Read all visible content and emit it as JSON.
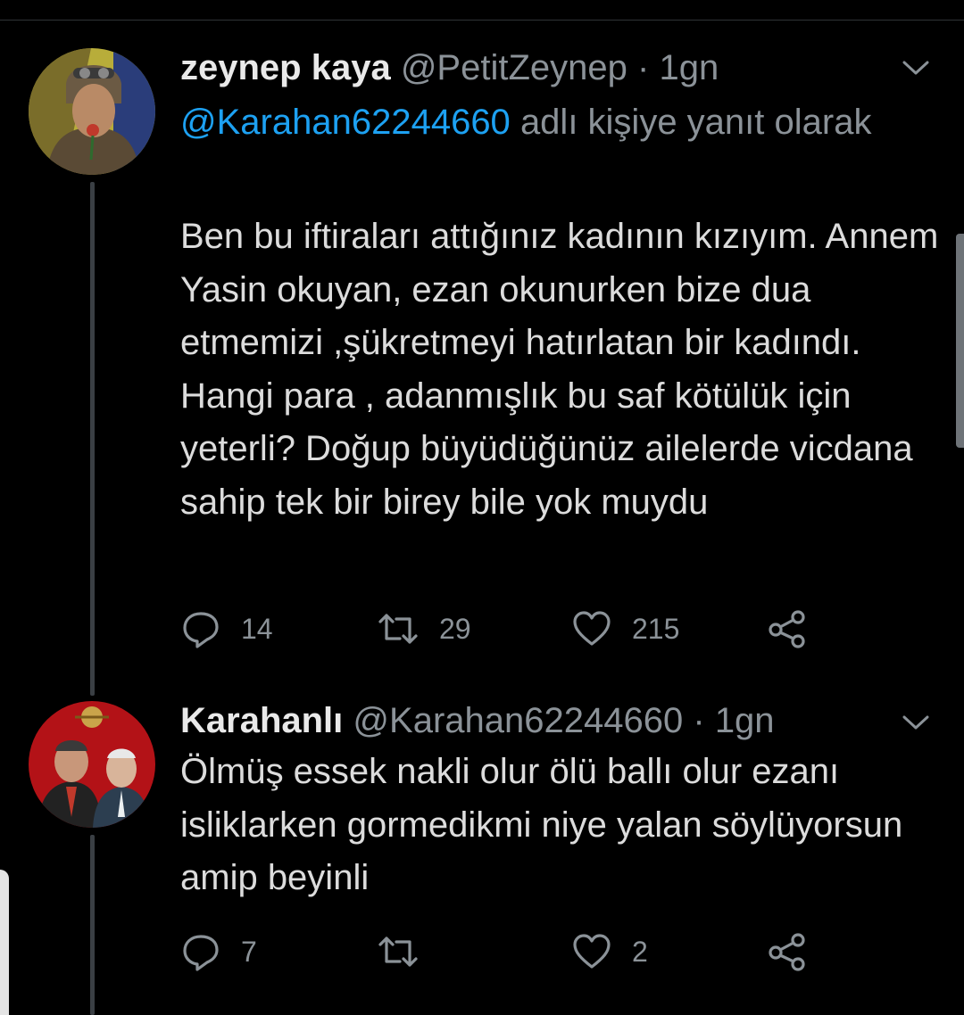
{
  "tweets": [
    {
      "display_name": "zeynep kaya",
      "handle": "@PetitZeynep",
      "separator": "·",
      "time": "1gn",
      "reply_to_handle": "@Karahan62244660",
      "reply_to_suffix": "adlı kişiye yanıt olarak",
      "text": "Ben bu iftiraları attığınız kadının kızıyım. Annem Yasin okuyan, ezan okunurken bize dua etmemizi ,şükretmeyi hatırlatan bir kadındı. Hangi para , adanmışlık bu saf kötülük için yeterli? Doğup büyüdüğünüz ailelerde vicdana sahip tek bir birey bile yok muydu",
      "replies": "14",
      "retweets": "29",
      "likes": "215"
    },
    {
      "display_name": "Karahanlı",
      "handle": "@Karahan62244660",
      "separator": "·",
      "time": "1gn",
      "text": "Ölmüş essek nakli olur ölü ballı olur ezanı isliklarken gormedikmi niye yalan söylüyorsun amip beyinli",
      "replies": "7",
      "retweets": "",
      "likes": "2"
    }
  ],
  "icons": {
    "reply": "reply-icon",
    "retweet": "retweet-icon",
    "like": "heart-icon",
    "share": "share-icon",
    "menu": "chevron-down-icon"
  },
  "colors": {
    "background": "#000000",
    "link": "#1da1f2",
    "secondary_text": "#8b9298"
  }
}
